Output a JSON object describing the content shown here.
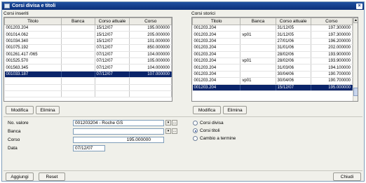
{
  "window": {
    "title": "Corsi divisa e titoli",
    "close_label": "×"
  },
  "left": {
    "label": "Corsi inseriti",
    "columns": [
      "Titolo",
      "Banca",
      "Corso attuale",
      "Corso"
    ],
    "rows": [
      [
        "001203.204",
        "",
        "15/12/07",
        "195.000000"
      ],
      [
        "001014.062",
        "",
        "15/12/07",
        "205.000000"
      ],
      [
        "001034.340",
        "",
        "15/12/07",
        "101.000000"
      ],
      [
        "001075.192",
        "",
        "07/12/07",
        "850.000000"
      ],
      [
        "001261.417 /065",
        "",
        "07/12/07",
        "104.000000"
      ],
      [
        "001525.570",
        "",
        "07/12/07",
        "105.000000"
      ],
      [
        "001563.345",
        "",
        "07/12/07",
        "104.000000"
      ],
      [
        "001033.187",
        "",
        "07/12/07",
        "107.000000"
      ],
      [
        "",
        "",
        "",
        ""
      ],
      [
        "",
        "",
        "",
        ""
      ],
      [
        "",
        "",
        "",
        ""
      ]
    ],
    "selected_index": 7,
    "modify_label": "Modifica",
    "delete_label": "Elimina"
  },
  "right": {
    "label": "Corsi storici",
    "columns": [
      "Titolo",
      "Banca",
      "Corso attuale",
      "Corso"
    ],
    "rows": [
      [
        "001203.204",
        "",
        "31/12/05",
        "197.300000"
      ],
      [
        "001203.204",
        "vp01",
        "31/12/05",
        "197.300000"
      ],
      [
        "001203.204",
        "",
        "27/01/06",
        "196.200000"
      ],
      [
        "001203.204",
        "",
        "31/01/06",
        "202.000000"
      ],
      [
        "001203.204",
        "",
        "28/02/06",
        "193.900000"
      ],
      [
        "001203.204",
        "vp01",
        "28/02/06",
        "193.900000"
      ],
      [
        "001203.204",
        "",
        "31/03/06",
        "194.100000"
      ],
      [
        "001203.204",
        "",
        "30/04/06",
        "190.700000"
      ],
      [
        "001203.204",
        "vp01",
        "30/04/06",
        "190.700000"
      ],
      [
        "001203.204",
        "",
        "15/12/07",
        "195.000000"
      ]
    ],
    "selected_index": 9,
    "modify_label": "Modifica",
    "delete_label": "Elimina"
  },
  "form": {
    "security_label": "No. valore",
    "security_value": "001203204     - Roche GS",
    "bank_label": "Banca",
    "bank_value": "",
    "price_label": "Corso",
    "price_value": "195.000000",
    "date_label": "Data",
    "date_value": "07/12/07"
  },
  "options": {
    "currency_label": "Corsi divisa",
    "securities_label": "Corsi titoli",
    "forward_label": "Cambio a termine",
    "selected": "securities"
  },
  "footer": {
    "add_label": "Aggiungi",
    "reset_label": "Reset",
    "close_label": "Chiudi"
  }
}
